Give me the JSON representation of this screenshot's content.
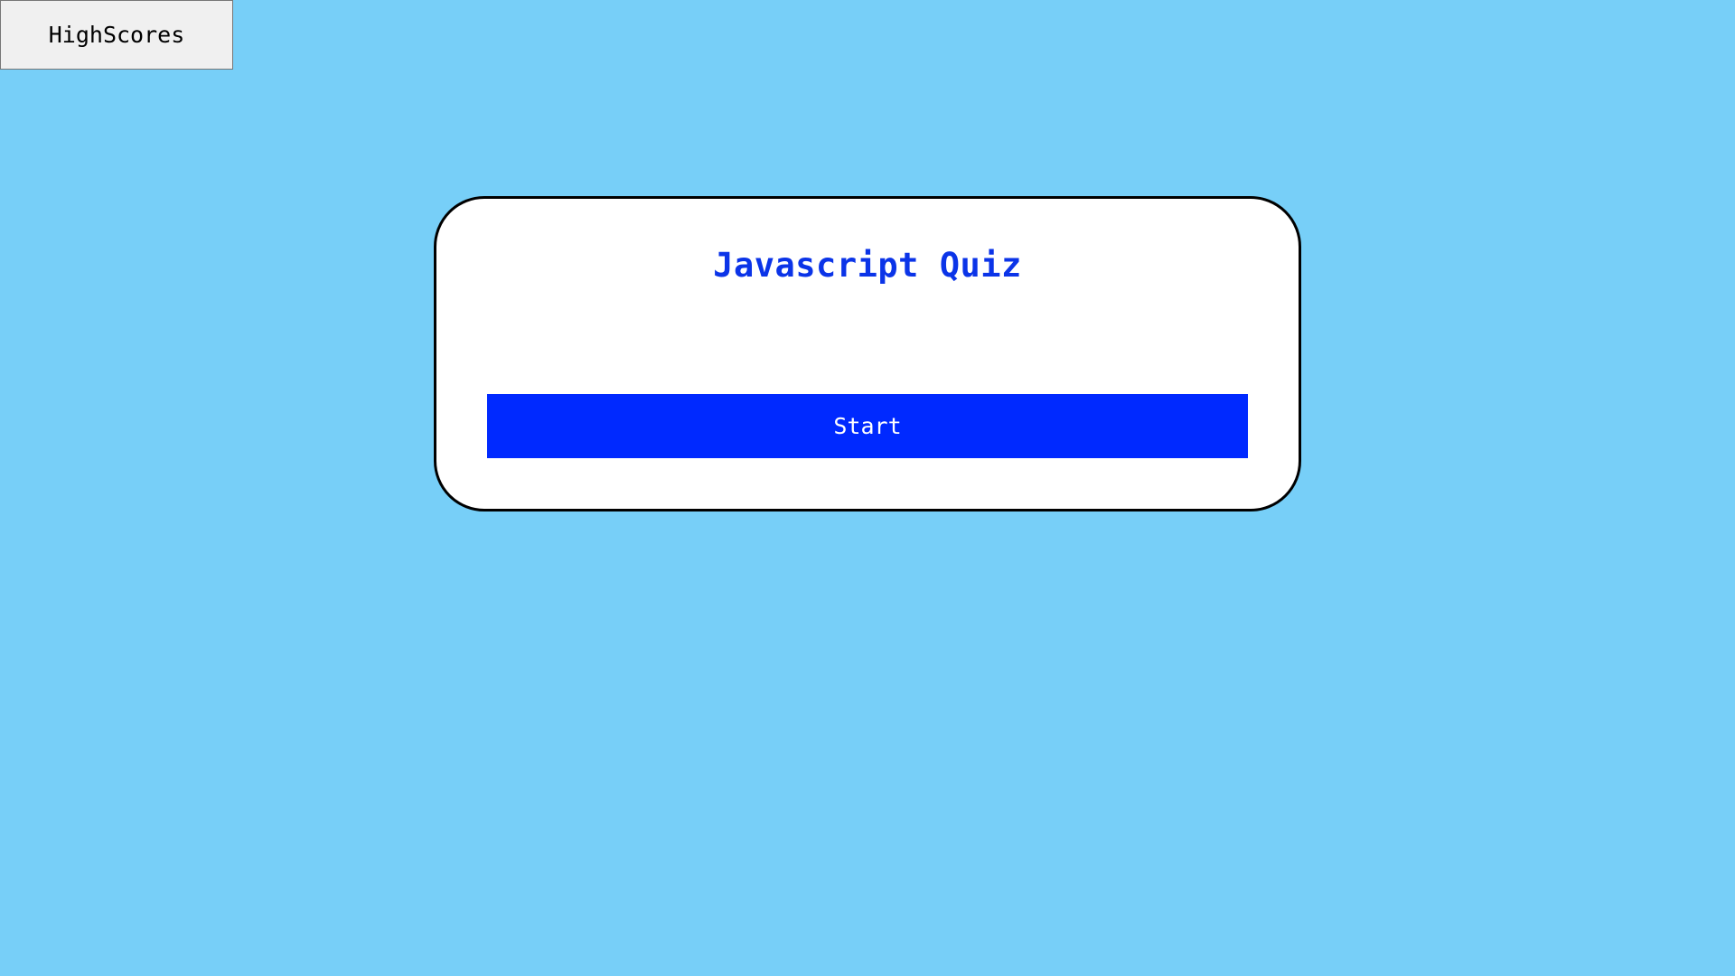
{
  "header": {
    "highscores_label": "HighScores"
  },
  "quiz": {
    "title": "Javascript Quiz",
    "start_label": "Start"
  },
  "colors": {
    "page_background": "#77cff8",
    "card_background": "#ffffff",
    "title_color": "#0b34e8",
    "start_button": "#0029ff",
    "highscores_button": "#f0f0f0"
  }
}
